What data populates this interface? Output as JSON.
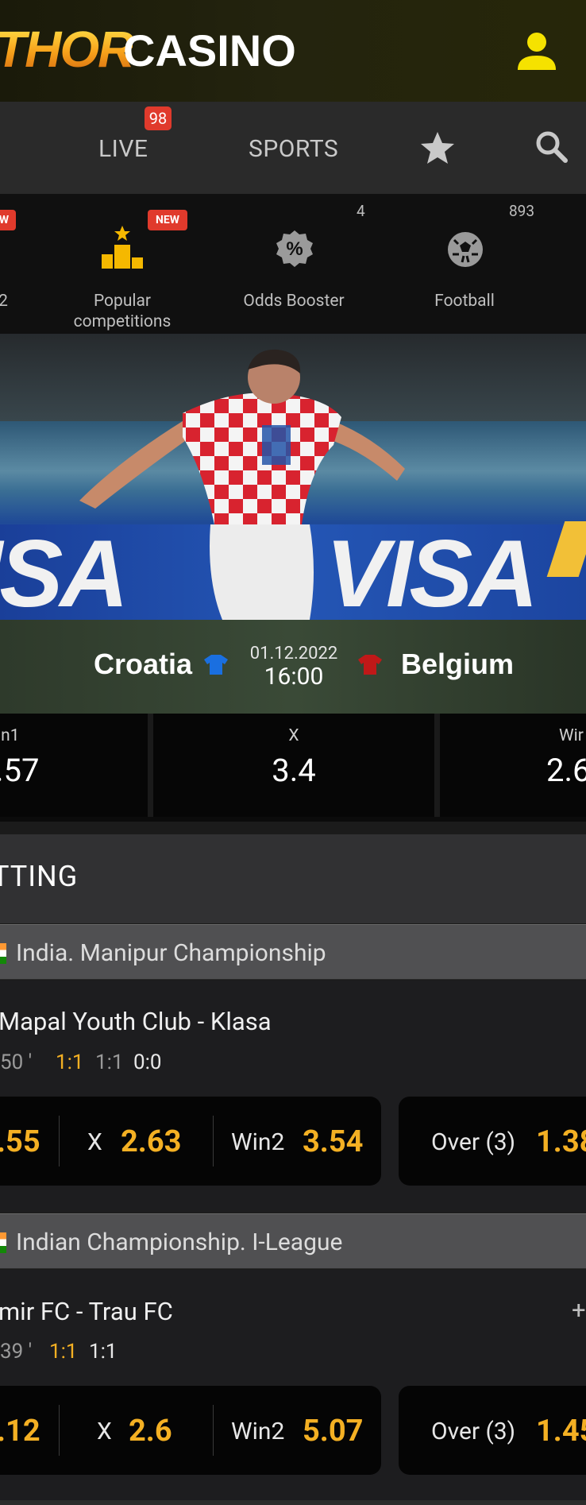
{
  "header": {
    "logo_part1": "THOR",
    "logo_part2": "CASINO"
  },
  "nav": {
    "live_label": "LIVE",
    "live_count": "98",
    "sports_label": "SPORTS"
  },
  "categories": [
    {
      "label": "2",
      "badge": "W"
    },
    {
      "label": "Popular competitions",
      "badge": "NEW",
      "line1": "Popular",
      "line2": "competitions"
    },
    {
      "label": "Odds Booster",
      "count": "4"
    },
    {
      "label": "Football",
      "count": "893"
    }
  ],
  "featured": {
    "banner_text": "ISA",
    "banner_text2": "VISA",
    "home": "Croatia",
    "away": "Belgium",
    "date": "01.12.2022",
    "time": "16:00",
    "home_kit_color": "#1a6fe0",
    "away_kit_color": "#c01818",
    "odds": [
      {
        "label": "in1",
        "value": ".57"
      },
      {
        "label": "X",
        "value": "3.4"
      },
      {
        "label": "Wir",
        "value": "2.6"
      }
    ]
  },
  "live_betting": {
    "title": "TTING"
  },
  "leagues": [
    {
      "name": "India. Manipur Championship",
      "match": {
        "teams": "Mapal Youth Club - Klasa",
        "minute": "50 '",
        "score_main": "1:1",
        "score_half1": "1:1",
        "score_half2": "0:0",
        "win1_value": ".55",
        "x_label": "X",
        "x_value": "2.63",
        "win2_label": "Win2",
        "win2_value": "3.54",
        "total_label": "Over (3)",
        "total_value": "1.38"
      }
    },
    {
      "name": "Indian Championship. I-League",
      "match": {
        "teams": "mir FC - Trau FC",
        "minute": "39 '",
        "score_main": "1:1",
        "score_half1": "1:1",
        "more": "+",
        "win1_value": ".12",
        "x_label": "X",
        "x_value": "2.6",
        "win2_label": "Win2",
        "win2_value": "5.07",
        "total_label": "Over (3)",
        "total_value": "1.45"
      }
    }
  ],
  "colors": {
    "accent": "#f4b023",
    "badge": "#e03a2c",
    "icon": "#f5b800"
  }
}
